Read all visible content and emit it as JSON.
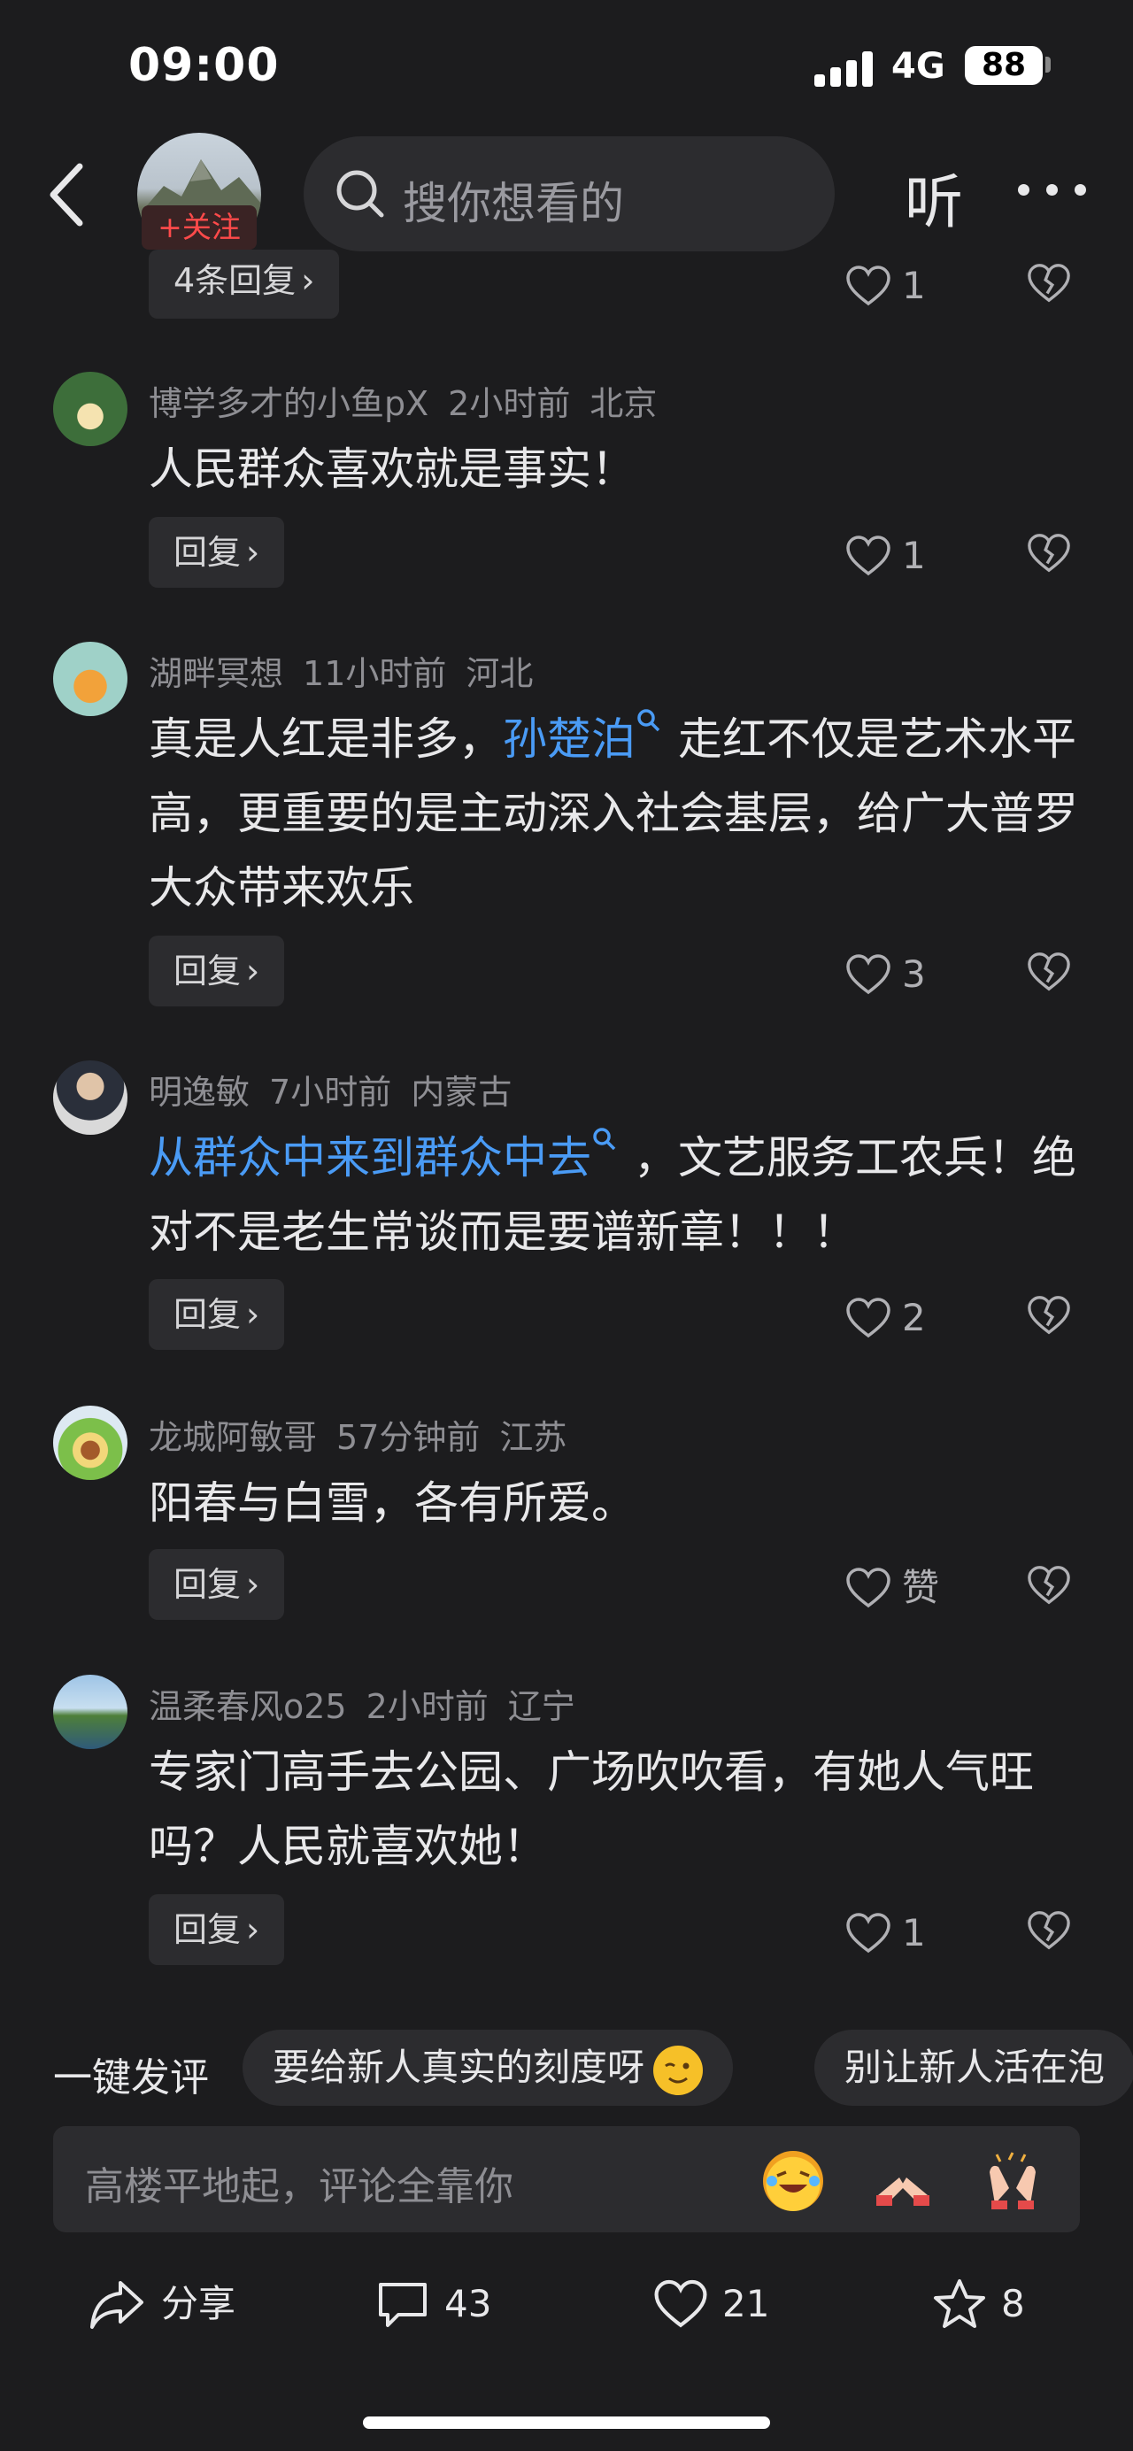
{
  "status_bar": {
    "time": "09:00",
    "network": "4G",
    "battery": "88"
  },
  "header": {
    "follow_label": "+关注",
    "search_placeholder": "搜你想看的",
    "listen_label": "听"
  },
  "top_partial": {
    "replies_label": "4条回复",
    "likes": "1"
  },
  "comments": [
    {
      "user": "博学多才的小鱼pX",
      "time": "2小时前",
      "location": "北京",
      "text": "人民群众喜欢就是事实！",
      "reply_label": "回复",
      "likes": "1"
    },
    {
      "user": "湖畔冥想",
      "time": "11小时前",
      "location": "河北",
      "text_parts": [
        "真是人红是非多，",
        "孙楚泊",
        "走红不仅是艺术水平高，更重要的是主动深入社会基层，给广大普罗大众带来欢乐"
      ],
      "reply_label": "回复",
      "likes": "3"
    },
    {
      "user": "明逸敏",
      "time": "7小时前",
      "location": "内蒙古",
      "text_parts": [
        "从群众中来到群众中去",
        "，文艺服务工农兵！绝对不是老生常谈而是要谱新章！！！"
      ],
      "reply_label": "回复",
      "likes": "2"
    },
    {
      "user": "龙城阿敏哥",
      "time": "57分钟前",
      "location": "江苏",
      "text": "阳春与白雪，各有所爱。",
      "reply_label": "回复",
      "likes": "赞"
    },
    {
      "user": "温柔春风o25",
      "time": "2小时前",
      "location": "辽宁",
      "text": "专家门高手去公园、广场吹吹看，有她人气旺吗？人民就喜欢她！",
      "reply_label": "回复",
      "likes": "1"
    }
  ],
  "quick_reply": {
    "label": "一键发评",
    "chips": [
      "要给新人真实的刻度呀",
      "别让新人活在泡"
    ]
  },
  "comment_input": {
    "placeholder": "高楼平地起，评论全靠你",
    "emojis": [
      "laughing-crying-emoji",
      "pointing-hands-emoji",
      "clapping-hands-emoji"
    ]
  },
  "bottom_bar": {
    "share_label": "分享",
    "comments_count": "43",
    "likes_count": "21",
    "favorites_count": "8"
  },
  "colors": {
    "background": "#1c1c1e",
    "link": "#4a9bf5",
    "follow": "#ff4a4a"
  }
}
